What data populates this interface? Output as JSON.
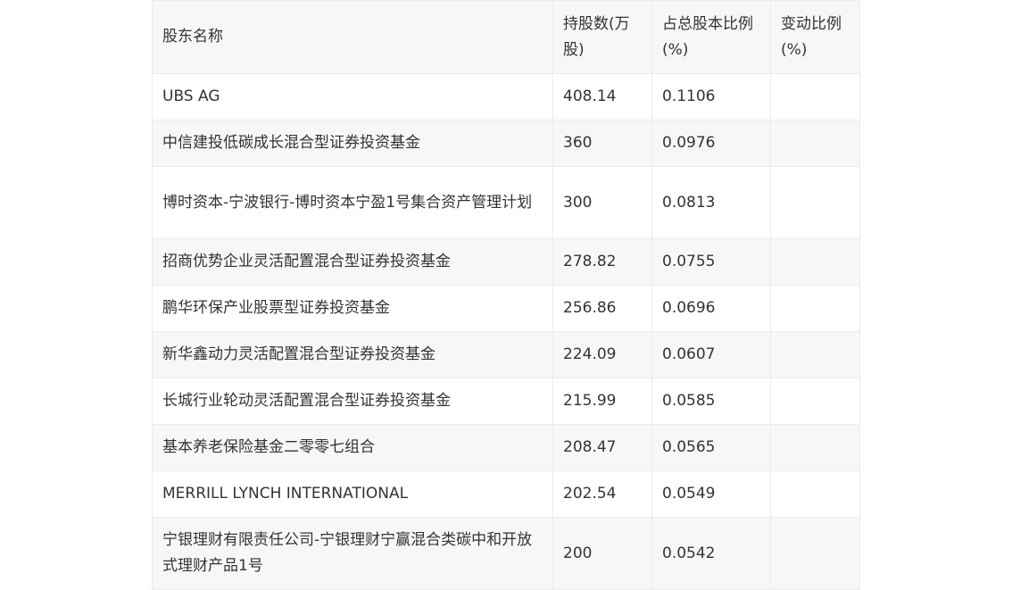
{
  "table": {
    "headers": [
      "股东名称",
      "持股数(万股)",
      "占总股本比例(%)",
      "变动比例(%)"
    ],
    "rows": [
      {
        "name": "UBS AG",
        "shares": "408.14",
        "ratio": "0.1106",
        "change": ""
      },
      {
        "name": "中信建投低碳成长混合型证券投资基金",
        "shares": "360",
        "ratio": "0.0976",
        "change": ""
      },
      {
        "name": "博时资本-宁波银行-博时资本宁盈1号集合资产管理计划",
        "shares": "300",
        "ratio": "0.0813",
        "change": ""
      },
      {
        "name": "招商优势企业灵活配置混合型证券投资基金",
        "shares": "278.82",
        "ratio": "0.0755",
        "change": ""
      },
      {
        "name": "鹏华环保产业股票型证券投资基金",
        "shares": "256.86",
        "ratio": "0.0696",
        "change": ""
      },
      {
        "name": "新华鑫动力灵活配置混合型证券投资基金",
        "shares": "224.09",
        "ratio": "0.0607",
        "change": ""
      },
      {
        "name": "长城行业轮动灵活配置混合型证券投资基金",
        "shares": "215.99",
        "ratio": "0.0585",
        "change": ""
      },
      {
        "name": "基本养老保险基金二零零七组合",
        "shares": "208.47",
        "ratio": "0.0565",
        "change": ""
      },
      {
        "name": "MERRILL LYNCH INTERNATIONAL",
        "shares": "202.54",
        "ratio": "0.0549",
        "change": ""
      },
      {
        "name": "宁银理财有限责任公司-宁银理财宁赢混合类碳中和开放式理财产品1号",
        "shares": "200",
        "ratio": "0.0542",
        "change": ""
      }
    ]
  }
}
